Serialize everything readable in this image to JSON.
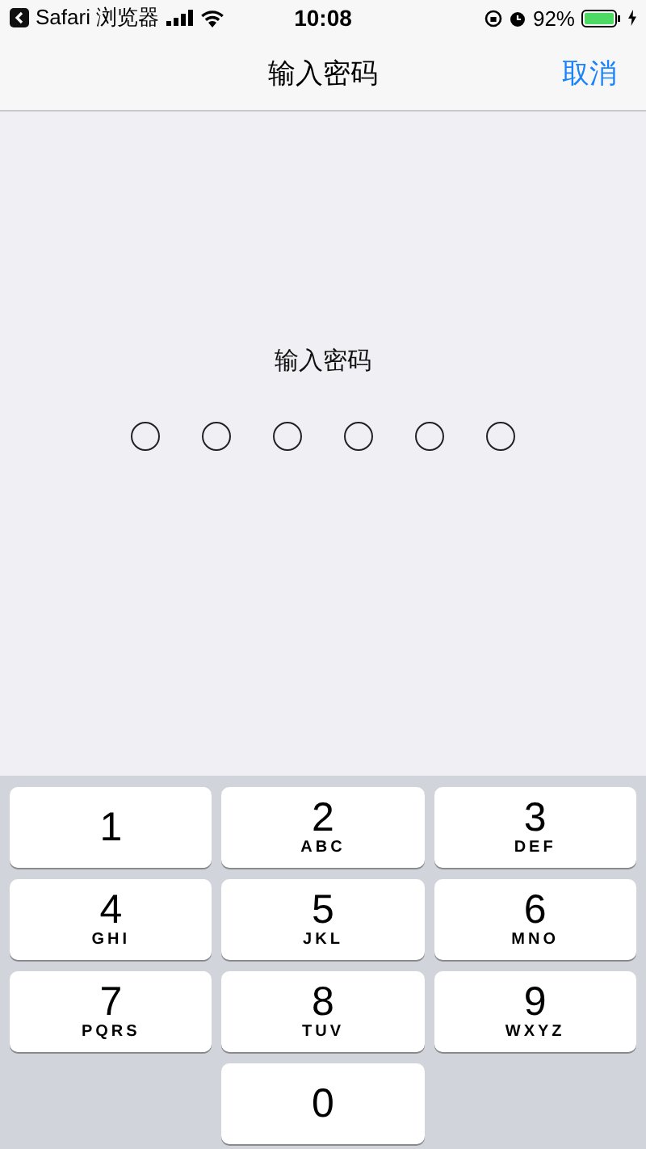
{
  "status_bar": {
    "back_app": "Safari 浏览器",
    "time": "10:08",
    "battery": "92%"
  },
  "nav_bar": {
    "title": "输入密码",
    "cancel": "取消"
  },
  "prompt": "输入密码",
  "passcode_dots": [
    {
      "filled": false
    },
    {
      "filled": false
    },
    {
      "filled": false
    },
    {
      "filled": false
    },
    {
      "filled": false
    },
    {
      "filled": false
    }
  ],
  "keypad": [
    {
      "digit": "1"
    },
    {
      "digit": "2",
      "letters": "ABC"
    },
    {
      "digit": "3",
      "letters": "DEF"
    },
    {
      "digit": "4",
      "letters": "GHI"
    },
    {
      "digit": "5",
      "letters": "JKL"
    },
    {
      "digit": "6",
      "letters": "MNO"
    },
    {
      "digit": "7",
      "letters": "PQRS"
    },
    {
      "digit": "8",
      "letters": "TUV"
    },
    {
      "digit": "9",
      "letters": "WXYZ"
    },
    {
      "digit": "0"
    }
  ]
}
